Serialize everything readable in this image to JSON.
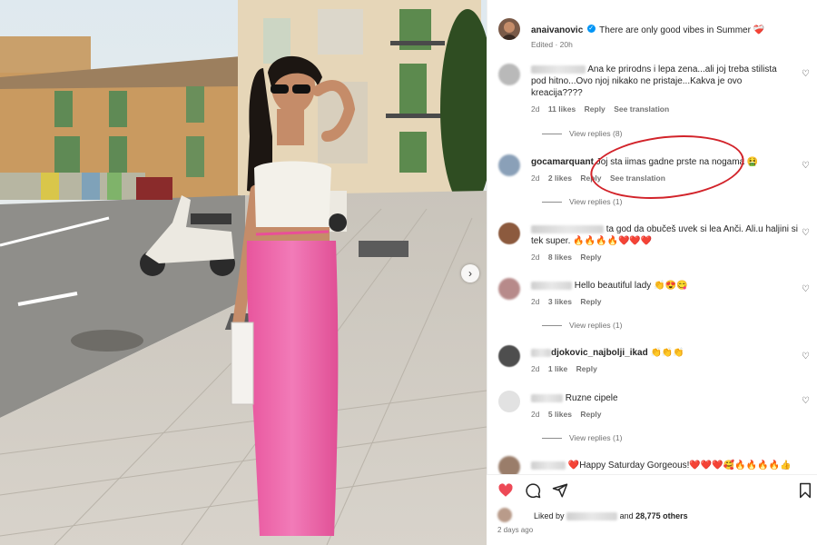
{
  "post": {
    "username": "anaivanovic",
    "caption": "There are only good vibes in Summer ❤️‍🩹",
    "edited": "Edited · 20h"
  },
  "comments": [
    {
      "text": "Ana ke prirodns i lepa zena...ali joj treba stilista pod hitno...Ovo njoj nikako ne pristaje...Kakva je ovo kreacija????",
      "age": "2d",
      "likes": "11 likes",
      "reply": "Reply",
      "translate": "See translation",
      "view_replies": "View replies (8)"
    },
    {
      "username": "gocamarquant",
      "text": "Joj sta iimas gadne prste na nogama 🤮",
      "age": "2d",
      "likes": "2 likes",
      "reply": "Reply",
      "translate": "See translation",
      "view_replies": "View replies (1)"
    },
    {
      "text": "ta god da obučeš uvek si lea Anči. Ali.u haljini si tek super. 🔥🔥🔥🔥❤️❤️❤️",
      "age": "2d",
      "likes": "8 likes",
      "reply": "Reply"
    },
    {
      "text": "Hello beautiful lady 👏😍😋",
      "age": "2d",
      "likes": "3 likes",
      "reply": "Reply",
      "view_replies": "View replies (1)"
    },
    {
      "username": "djokovic_najbolji_ikad",
      "text": "👏👏👏",
      "age": "2d",
      "likes": "1 like",
      "reply": "Reply"
    },
    {
      "text": "Ruzne cipele",
      "age": "2d",
      "likes": "5 likes",
      "reply": "Reply",
      "view_replies": "View replies (1)"
    },
    {
      "text": "❤️Happy Saturday Gorgeous!❤️❤️❤️🥰🔥🔥🔥🔥👍"
    }
  ],
  "footer": {
    "liked_by_prefix": "Liked by",
    "liked_and": "and",
    "others": "28,775 others",
    "posted": "2 days ago"
  },
  "colors": {
    "accent_red": "#d2232a",
    "heart_red": "#ed4956",
    "verified_blue": "#0095f6"
  },
  "icons": [
    "heart-icon",
    "comment-icon",
    "share-icon",
    "bookmark-icon",
    "verified-icon",
    "chevron-right-icon"
  ]
}
